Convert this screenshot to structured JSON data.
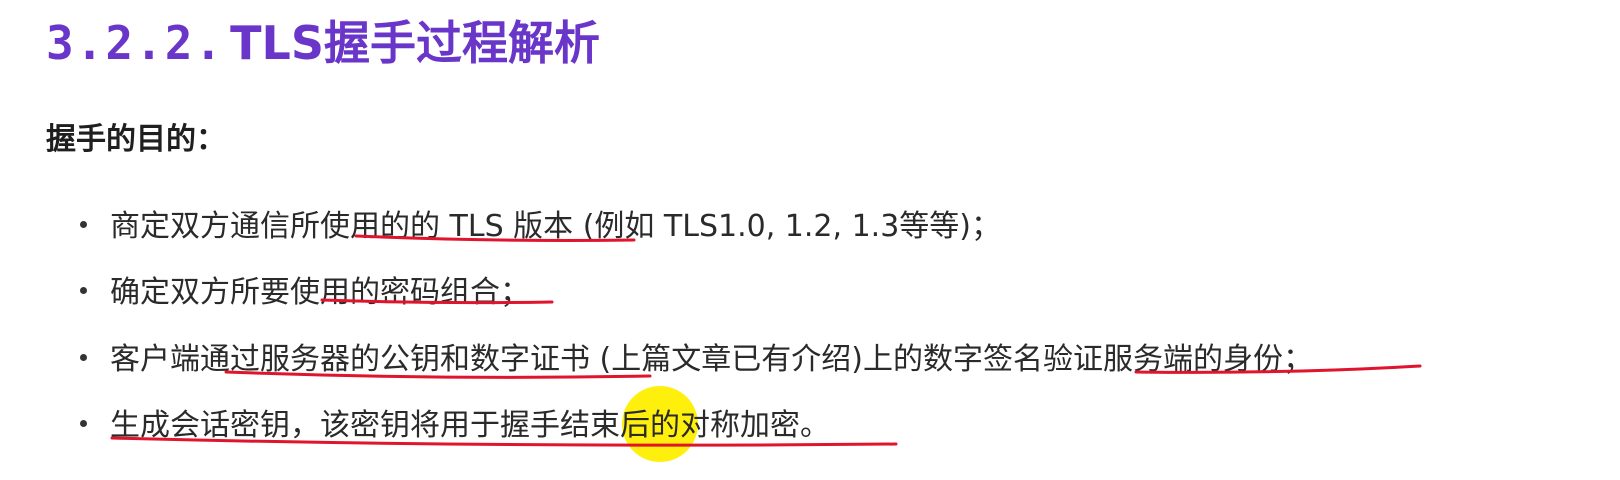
{
  "heading": {
    "number": "3.2.2.",
    "title": "TLS握手过程解析"
  },
  "subheading": "握手的目的：",
  "bullets": [
    {
      "text": "商定双方通信所使用的的 TLS 版本 (例如 TLS1.0, 1.2, 1.3等等)；"
    },
    {
      "text": "确定双方所要使用的密码组合；"
    },
    {
      "text": "客户端通过服务器的公钥和数字证书 (上篇文章已有介绍)上的数字签名验证服务端的身份；"
    },
    {
      "text": "生成会话密钥，该密钥将用于握手结束后的对称加密。"
    }
  ],
  "colors": {
    "heading": "#6a35c9",
    "underline": "#e0142c",
    "highlight": "#ffee00"
  },
  "icons": {
    "bullet": "bullet-dot",
    "pointer": "cursor-highlight"
  }
}
